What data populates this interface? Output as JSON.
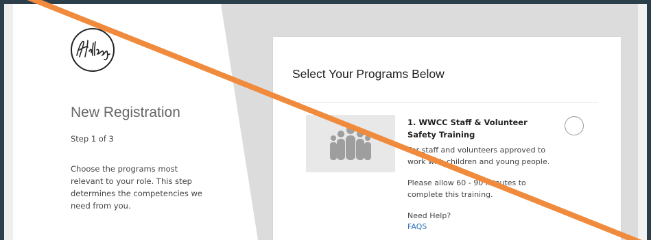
{
  "logo": {
    "text": "Hillsong"
  },
  "left_panel": {
    "title": "New Registration",
    "step": "Step 1 of 3",
    "description": "Choose the programs most relevant to your role. This step determines the competencies we need from you."
  },
  "main": {
    "heading": "Select Your Programs Below",
    "programs": [
      {
        "name": "1. WWCC Staff & Volunteer Safety Training",
        "description": "For staff and volunteers approved to work with children and young people.",
        "time_note": "Please allow 60 - 90 minutes to complete this training.",
        "help_label": "Need Help?",
        "help_link": "FAQS",
        "icon": "people-group-icon",
        "selected": false
      }
    ]
  },
  "colors": {
    "overlay_slash": "#f08a3c",
    "link": "#2a73b8",
    "frame": "#2c3e4a"
  }
}
